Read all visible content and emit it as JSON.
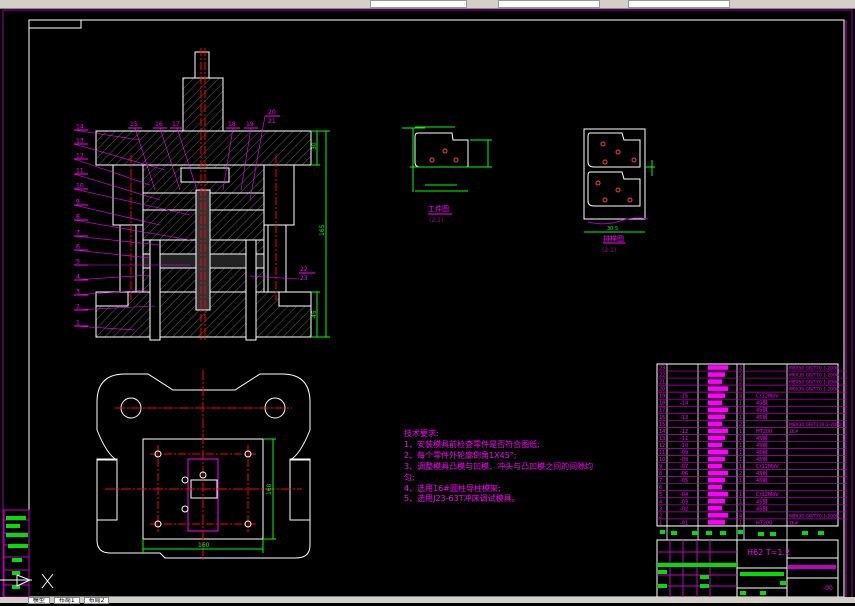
{
  "app": {
    "bottom_tabs": [
      "模型",
      "布局1",
      "布局2"
    ]
  },
  "colors": {
    "background": "#000000",
    "outline": "#ffffff",
    "label": "#ff00ff",
    "dimension": "#00ff00",
    "centerline": "#ff0000"
  },
  "section_view": {
    "part_numbers_left": [
      "14",
      "13",
      "12",
      "11",
      "10",
      "9",
      "8",
      "7",
      "6",
      "5",
      "4",
      "3",
      "2",
      "1"
    ],
    "part_numbers_top": [
      "15",
      "16",
      "17",
      "18",
      "19"
    ],
    "part_numbers_top_right": [
      "20",
      "21"
    ],
    "part_numbers_bottom_right": [
      "22",
      "23"
    ],
    "dim_total_height": "165",
    "dim_top": "30",
    "dim_bottom": "45"
  },
  "plan_view": {
    "dim_width": "160",
    "dim_height": "160"
  },
  "workpiece_view": {
    "title": "工件图",
    "scale": "(2:1)"
  },
  "layout_view": {
    "title": "排样图",
    "scale": "(2:1)",
    "dim_width": "30.5"
  },
  "tech_requirements": {
    "heading": "技术要求:",
    "items": [
      "1、安装模具前检查零件是否符合图纸;",
      "2、每个零件外轮廓倒角1X45°;",
      "3、调整模具凸模与凹模、冲头与凸凹模之间的间隙均",
      "匀;",
      "4、选用16#圆柱导柱模架;",
      "5、选用J23-63T冲床调试模具。"
    ]
  },
  "parts_list": [
    {
      "no": "23",
      "code": "",
      "qty": "2",
      "material": "",
      "note": "M8X50 GB/T70.1-2000"
    },
    {
      "no": "22",
      "code": "",
      "qty": "2",
      "material": "",
      "note": "M6X30 GB/T70.1-2000"
    },
    {
      "no": "21",
      "code": "",
      "qty": "2",
      "material": "",
      "note": "M8X50 GB/T70.1-2000"
    },
    {
      "no": "20",
      "code": "",
      "qty": "4",
      "material": "",
      "note": "M6X30 GB/T70.1-2000"
    },
    {
      "no": "19",
      "code": "-15",
      "qty": "4",
      "material": "Cr12MoV",
      "note": ""
    },
    {
      "no": "18",
      "code": "-14",
      "qty": "1",
      "material": "45钢",
      "note": ""
    },
    {
      "no": "17",
      "code": "",
      "qty": "1",
      "material": "45钢",
      "note": ""
    },
    {
      "no": "16",
      "code": "-13",
      "qty": "1",
      "material": "45钢",
      "note": ""
    },
    {
      "no": "15",
      "code": "",
      "qty": "2",
      "material": "",
      "note": "M8X30 GB/T119.1-2000"
    },
    {
      "no": "14",
      "code": "-12",
      "qty": "1",
      "material": "HT200",
      "note": "16#"
    },
    {
      "no": "13",
      "code": "-11",
      "qty": "1",
      "material": "45钢",
      "note": ""
    },
    {
      "no": "12",
      "code": "-10",
      "qty": "1",
      "material": "45钢",
      "note": ""
    },
    {
      "no": "11",
      "code": "-09",
      "qty": "1",
      "material": "45钢",
      "note": ""
    },
    {
      "no": "10",
      "code": "-08",
      "qty": "1",
      "material": "45钢",
      "note": ""
    },
    {
      "no": "9",
      "code": "-07",
      "qty": "1",
      "material": "Cr12MoV",
      "note": ""
    },
    {
      "no": "8",
      "code": "-06",
      "qty": "2",
      "material": "45钢",
      "note": ""
    },
    {
      "no": "7",
      "code": "-05",
      "qty": "1",
      "material": "45钢",
      "note": ""
    },
    {
      "no": "6",
      "code": "",
      "qty": "",
      "material": "",
      "note": ""
    },
    {
      "no": "5",
      "code": "-04",
      "qty": "1",
      "material": "Cr12MoV",
      "note": ""
    },
    {
      "no": "4",
      "code": "-03",
      "qty": "1",
      "material": "45钢",
      "note": ""
    },
    {
      "no": "3",
      "code": "-02",
      "qty": "1",
      "material": "45钢",
      "note": ""
    },
    {
      "no": "2",
      "code": "",
      "qty": "4",
      "material": "",
      "note": "M8X30 GB/T70.1-2000"
    },
    {
      "no": "1",
      "code": "-01",
      "qty": "1",
      "material": "HT200",
      "note": "16#"
    }
  ],
  "title_block": {
    "material": "H62  T=1.2",
    "drawing_no": "-00"
  }
}
